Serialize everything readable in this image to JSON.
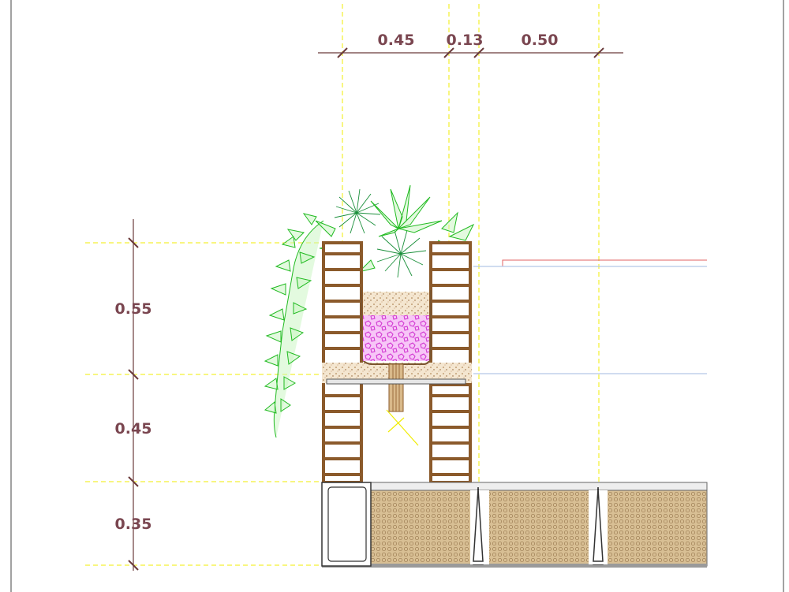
{
  "drawing": {
    "horizontal_dimensions": [
      "0.45",
      "0.13",
      "0.50"
    ],
    "vertical_dimensions": [
      "0.55",
      "0.45",
      "0.35"
    ]
  },
  "colors": {
    "dimension_text": "#7a4650",
    "dimension_line": "#6b3b3b",
    "guide_line": "#f0ec00",
    "brick": "#8b5a2b",
    "brick_fill": "#d9b98a",
    "soil": "#e6d2b5",
    "gravel": "#e050e0",
    "foliage": "#22bb22",
    "deck": "#6a6a6a",
    "insulation": "#c9a77c",
    "water_level": "#b4c8e6",
    "red_line": "#e06060"
  }
}
